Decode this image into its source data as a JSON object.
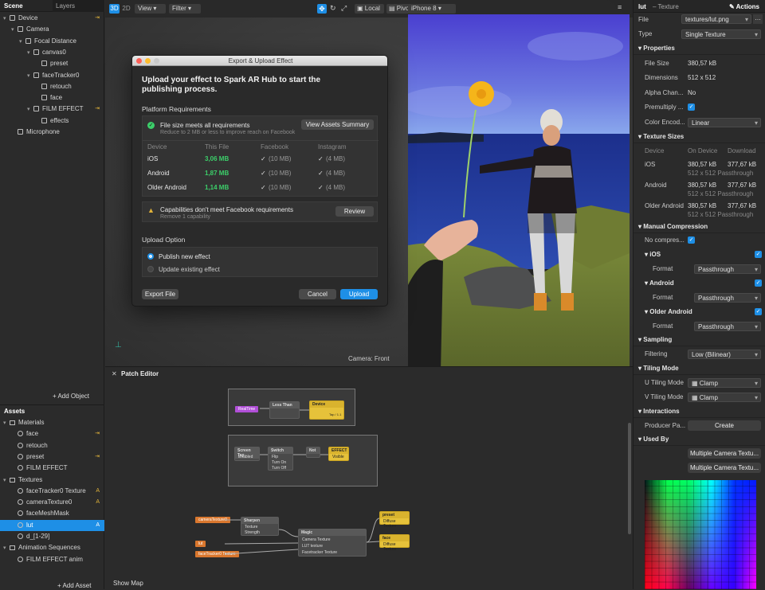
{
  "scene": {
    "tabs": [
      "Scene",
      "Layers"
    ],
    "items": [
      {
        "label": "Device",
        "indent": 0,
        "icon": "device-icon",
        "yellow": "⇥"
      },
      {
        "label": "Camera",
        "indent": 1,
        "icon": "camera-icon"
      },
      {
        "label": "Focal Distance",
        "indent": 2,
        "icon": "focal-icon"
      },
      {
        "label": "canvas0",
        "indent": 3,
        "icon": "canvas-icon"
      },
      {
        "label": "preset",
        "indent": 4,
        "icon": "rect-icon"
      },
      {
        "label": "faceTracker0",
        "indent": 3,
        "icon": "facetracker-icon"
      },
      {
        "label": "retouch",
        "indent": 4,
        "icon": "mesh-icon"
      },
      {
        "label": "face",
        "indent": 4,
        "icon": "mesh-icon"
      },
      {
        "label": "FILM EFFECT",
        "indent": 3,
        "icon": "rect-icon",
        "yellow": "⇥"
      },
      {
        "label": "effects",
        "indent": 4,
        "icon": "rect-icon"
      },
      {
        "label": "Microphone",
        "indent": 1,
        "icon": "mic-icon"
      }
    ],
    "add_object": "+ Add Object"
  },
  "assets": {
    "title": "Assets",
    "items": [
      {
        "label": "Materials",
        "indent": 0,
        "folder": true
      },
      {
        "label": "face",
        "indent": 1,
        "yellow": "⇥"
      },
      {
        "label": "retouch",
        "indent": 1
      },
      {
        "label": "preset",
        "indent": 1,
        "yellow": "⇥"
      },
      {
        "label": "FILM EFFECT",
        "indent": 1
      },
      {
        "label": "Textures",
        "indent": 0,
        "folder": true
      },
      {
        "label": "faceTracker0 Texture",
        "indent": 1,
        "yellow": "A"
      },
      {
        "label": "cameraTexture0",
        "indent": 1,
        "yellow": "A"
      },
      {
        "label": "faceMeshMask",
        "indent": 1
      },
      {
        "label": "lut",
        "indent": 1,
        "selected": true,
        "yellow": "A"
      },
      {
        "label": "d_[1-29]",
        "indent": 1
      },
      {
        "label": "Animation Sequences",
        "indent": 0,
        "folder": true
      },
      {
        "label": "FILM EFFECT anim",
        "indent": 1
      }
    ],
    "add_asset": "+ Add Asset"
  },
  "toolbar": {
    "mode_3d": "3D",
    "mode_2d": "2D",
    "view": "View",
    "filter": "Filter",
    "local": "Local",
    "pivot": "Pivot",
    "device": "iPhone 8"
  },
  "viewport": {
    "camera_label": "Camera: Front"
  },
  "dialog": {
    "title": "Export & Upload Effect",
    "heading": "Upload your effect to Spark AR Hub to start the publishing process.",
    "platform_title": "Platform Requirements",
    "file_ok": "File size meets all requirements",
    "file_ok_sub": "Reduce to 2 MB or less to improve reach on Facebook",
    "view_summary": "View Assets Summary",
    "cols": [
      "Device",
      "This File",
      "Facebook",
      "Instagram"
    ],
    "rows": [
      {
        "device": "iOS",
        "size": "3,06 MB",
        "fb": "(10 MB)",
        "ig": "(4 MB)"
      },
      {
        "device": "Android",
        "size": "1,87 MB",
        "fb": "(10 MB)",
        "ig": "(4 MB)"
      },
      {
        "device": "Older Android",
        "size": "1,14 MB",
        "fb": "(10 MB)",
        "ig": "(4 MB)"
      }
    ],
    "warn": "Capabilities don't meet Facebook requirements",
    "warn_sub": "Remove 1 capability",
    "review": "Review",
    "upload_option": "Upload Option",
    "publish_new": "Publish new effect",
    "update_existing": "Update existing effect",
    "export_file": "Export File",
    "cancel": "Cancel",
    "upload": "Upload"
  },
  "patch": {
    "title": "Patch Editor",
    "show_map": "Show Map",
    "nodes": {
      "n1": "Less Than",
      "n2": "Device",
      "n3": "Screen Tap",
      "n4": "Switch",
      "n5": "Not",
      "n6": "Sharpen",
      "n7": "Magic",
      "n8": "preset",
      "n9": "face"
    },
    "pins": {
      "p1": "Enabled",
      "p2": "Texture",
      "p3": "Strength",
      "p4": "Flip",
      "p5": "Turn On",
      "p6": "Turn Off",
      "p7": "Camera Texture",
      "p8": "LUT texture",
      "p9": "Facetracker Texture",
      "p10": "Diffuse Texture",
      "p11": "Visible",
      "p12": "cameraTexture0",
      "p13": "lut",
      "p14": "faceTracker0 Texture",
      "p15": "RealTime",
      "p16": "EFFECT",
      "p17": "Tap / 1.1"
    }
  },
  "inspector": {
    "name": "lut",
    "kind": "– Texture",
    "actions": "Actions",
    "file_label": "File",
    "file_value": "textures/lut.png",
    "type_label": "Type",
    "type_value": "Single Texture",
    "properties": "Properties",
    "file_size_label": "File Size",
    "file_size": "380,57 kB",
    "dimensions_label": "Dimensions",
    "dimensions": "512 x 512",
    "alpha_label": "Alpha Chan...",
    "alpha": "No",
    "premult_label": "Premultiply ...",
    "color_enc_label": "Color Encod...",
    "color_enc": "Linear",
    "texture_sizes": "Texture Sizes",
    "ts_cols": [
      "Device",
      "On Device",
      "Download"
    ],
    "ts_rows": [
      {
        "device": "iOS",
        "on": "380,57 kB",
        "dl": "377,67 kB",
        "sub": "512 x 512 Passthrough"
      },
      {
        "device": "Android",
        "on": "380,57 kB",
        "dl": "377,67 kB",
        "sub": "512 x 512 Passthrough"
      },
      {
        "device": "Older Android",
        "on": "380,57 kB",
        "dl": "377,67 kB",
        "sub": "512 x 512 Passthrough"
      }
    ],
    "manual": "Manual Compression",
    "no_comp": "No compres...",
    "ios": "iOS",
    "android": "Android",
    "older_android": "Older Android",
    "format_label": "Format",
    "format_value": "Passthrough",
    "sampling": "Sampling",
    "filtering_label": "Filtering",
    "filtering": "Low (Bilinear)",
    "tiling": "Tiling Mode",
    "u_label": "U Tiling Mode",
    "v_label": "V Tiling Mode",
    "clamp": "Clamp",
    "interactions": "Interactions",
    "producer_label": "Producer Pa...",
    "create": "Create",
    "used_by": "Used By",
    "used1": "Multiple Camera Textu...",
    "used2": "Multiple Camera Textu..."
  },
  "colors": {
    "accent": "#1e8fe6",
    "green": "#3ccf6a",
    "yellow": "#e0b23a",
    "node_yellow": "#e6c23a",
    "node_orange": "#d9772e",
    "node_purple": "#b14fd8"
  }
}
